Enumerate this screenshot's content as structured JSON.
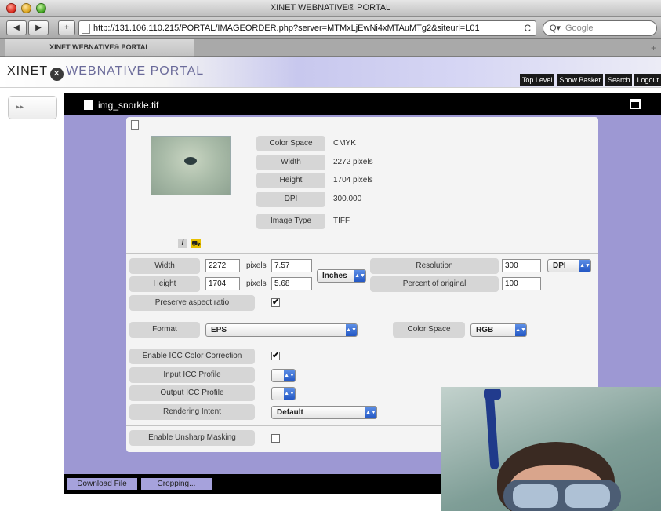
{
  "window": {
    "title": "XINET WEBNATIVE® PORTAL"
  },
  "toolbar": {
    "back": "◀",
    "forward": "▶",
    "add": "+",
    "url": "http://131.106.110.215/PORTAL/IMAGEORDER.php?server=MTMxLjEwNi4xMTAuMTg2&siteurl=L01",
    "reload": "C",
    "search_placeholder": "Google",
    "search_glyph": "Q▾"
  },
  "tab": {
    "label": "XINET WEBNATIVE® PORTAL",
    "new_tab": "+"
  },
  "portal": {
    "logo_xinet": "XINET",
    "logo_mark": "✕",
    "logo_webnative": "WEBNATIVE PORTAL",
    "nav": [
      "Top Level",
      "Show Basket",
      "Search",
      "Logout"
    ]
  },
  "sidebar": {
    "toggle_glyph": "▸▸"
  },
  "file": {
    "name": "img_snorkle.tif"
  },
  "image_info": {
    "rows": [
      {
        "label": "Color Space",
        "value": "CMYK"
      },
      {
        "label": "Width",
        "value": "2272 pixels"
      },
      {
        "label": "Height",
        "value": "1704 pixels"
      },
      {
        "label": "DPI",
        "value": "300.000"
      },
      {
        "label": "Image Type",
        "value": "TIFF"
      }
    ],
    "info_glyph": "i",
    "cart_glyph": "⛟"
  },
  "size": {
    "width_label": "Width",
    "width_px": "2272",
    "px_unit": "pixels",
    "width_units": "7.57",
    "height_label": "Height",
    "height_px": "1704",
    "height_units": "5.68",
    "unit_select": "Inches",
    "resolution_label": "Resolution",
    "resolution": "300",
    "resolution_unit": "DPI",
    "percent_label": "Percent of original",
    "percent": "100",
    "aspect_label": "Preserve aspect ratio",
    "aspect_checked": "✔"
  },
  "format": {
    "format_label": "Format",
    "format_value": "EPS",
    "colorspace_label": "Color Space",
    "colorspace_value": "RGB"
  },
  "icc": {
    "enable_label": "Enable ICC Color Correction",
    "enable_checked": "✔",
    "input_label": "Input ICC Profile",
    "output_label": "Output ICC Profile",
    "intent_label": "Rendering Intent",
    "intent_value": "Default"
  },
  "unsharp": {
    "label": "Enable Unsharp Masking"
  },
  "select_arrows": "▲▼",
  "bottom": {
    "download": "Download File",
    "cropping": "Cropping..."
  }
}
